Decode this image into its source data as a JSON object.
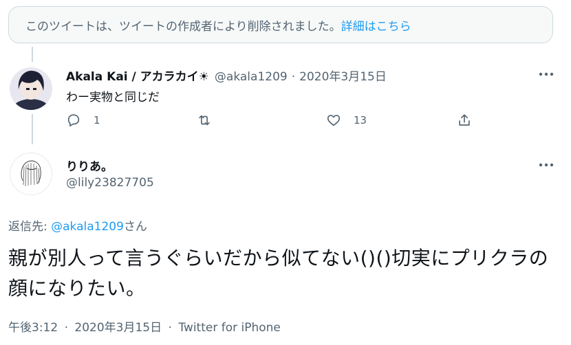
{
  "notice": {
    "text": "このツイートは、ツイートの作成者により削除されました。",
    "link": "詳細はこちら"
  },
  "tweet1": {
    "display_name": "Akala Kai / アカラカイ☀︎",
    "handle": "@akala1209",
    "separator": "·",
    "date": "2020年3月15日",
    "text": "わー実物と同じだ",
    "reply_count": "1",
    "like_count": "13"
  },
  "tweet2": {
    "display_name": "りりあ。",
    "handle": "@lily23827705",
    "replying_prefix": "返信先: ",
    "replying_handle": "@akala1209",
    "replying_suffix": "さん",
    "text": "親が別人って言うぐらいだから似てない()()切実にプリクラの顔になりたい。",
    "time": "午後3:12",
    "date": "2020年3月15日",
    "separator": "·",
    "source": "Twitter for iPhone"
  },
  "colors": {
    "accent": "#1d9bf0",
    "secondary_text": "#536471",
    "border": "#cfd9de"
  }
}
